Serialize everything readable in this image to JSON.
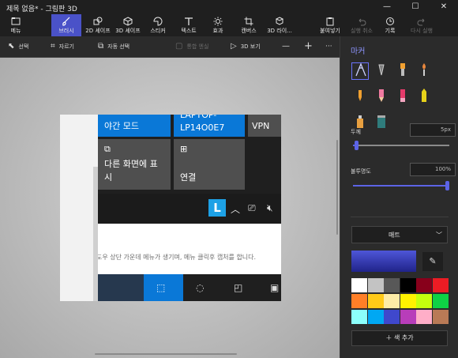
{
  "window": {
    "title": "제목 없음* - 그림판 3D",
    "minimize": "—",
    "maximize": "☐",
    "close": "✕"
  },
  "ribbon": {
    "menu": {
      "label": "메뉴",
      "icon": "folder-icon"
    },
    "brushes": {
      "label": "브러시",
      "icon": "brush-icon"
    },
    "shapes2d": {
      "label": "2D 셰이프",
      "icon": "shapes-2d-icon"
    },
    "shapes3d": {
      "label": "3D 셰이프",
      "icon": "cube-icon"
    },
    "stickers": {
      "label": "스티커",
      "icon": "sticker-icon"
    },
    "text": {
      "label": "텍스트",
      "icon": "text-icon"
    },
    "effects": {
      "label": "효과",
      "icon": "sun-icon"
    },
    "canvas": {
      "label": "캔버스",
      "icon": "crop-icon"
    },
    "library3d": {
      "label": "3D 라이...",
      "icon": "3d-library-icon"
    },
    "paste": {
      "label": "붙여넣기",
      "icon": "paste-icon"
    },
    "undo": {
      "label": "실행 취소",
      "icon": "undo-icon"
    },
    "history": {
      "label": "기록",
      "icon": "history-icon"
    },
    "redo": {
      "label": "다시 실행",
      "icon": "redo-icon"
    }
  },
  "commandbar": {
    "select": "선택",
    "crop": "자르기",
    "magic_select": "자동 선택",
    "group": "통합 엔실",
    "view3d": "3D 보기",
    "zoom_out": "—",
    "zoom_in": "+",
    "more": "···"
  },
  "screenshot": {
    "tile_night": "야간 모드",
    "tile_laptop_1": "LAPTOP-",
    "tile_laptop_2": "LP14O0E7",
    "tile_vpn": "VPN",
    "tile_project_1": "다른 화면에 표",
    "tile_project_2": "시",
    "tile_connect": "연결",
    "badge": "L",
    "note": "도우 상단 가운데 메뉴가 생기며, 메뉴 클릭후 캡처를 합니다."
  },
  "panel": {
    "title": "마커",
    "thickness_label": "두께",
    "thickness_value": "5px",
    "opacity_label": "불투명도",
    "opacity_value": "100%",
    "opacity_level": 1.0,
    "thickness_level": 0.03,
    "material": "매트",
    "add_color": "색 추가",
    "current_color": "#3a41c0",
    "brushes": [
      {
        "name": "marker-brush-icon",
        "selected": true
      },
      {
        "name": "calligraphy-pen-icon",
        "selected": false
      },
      {
        "name": "oil-brush-icon",
        "selected": false
      },
      {
        "name": "watercolor-brush-icon",
        "selected": false
      },
      {
        "name": "pixel-pen-icon",
        "selected": false
      },
      {
        "name": "pencil-icon",
        "selected": false
      },
      {
        "name": "eraser-icon",
        "selected": false
      },
      {
        "name": "crayon-icon",
        "selected": false
      },
      {
        "name": "spray-can-icon",
        "selected": false
      },
      {
        "name": "fill-bucket-icon",
        "selected": false
      }
    ],
    "palette": [
      "#ffffff",
      "#c3c3c3",
      "#585858",
      "#000000",
      "#88001b",
      "#ec1c24",
      "#ff7f27",
      "#ffca18",
      "#fdeca6",
      "#fff200",
      "#c4ff0e",
      "#0ed145",
      "#8cfffb",
      "#00a8f3",
      "#3f48cc",
      "#b83dba",
      "#ffaec8",
      "#b97a56"
    ]
  }
}
